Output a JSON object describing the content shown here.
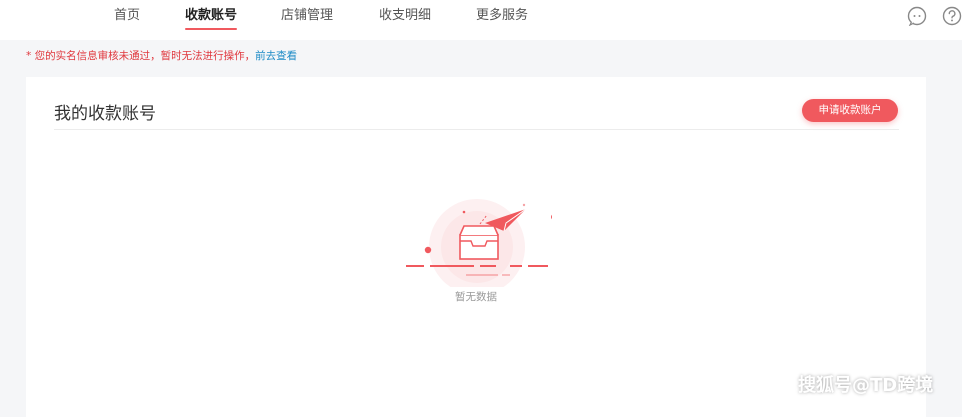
{
  "nav": {
    "items": [
      {
        "label": "首页"
      },
      {
        "label": "收款账号"
      },
      {
        "label": "店铺管理"
      },
      {
        "label": "收支明细"
      },
      {
        "label": "更多服务"
      }
    ],
    "active_index": 1,
    "icons": [
      "chat-bubble-icon",
      "help-question-icon"
    ]
  },
  "notice": {
    "message": "* 您的实名信息审核未通过，暂时无法进行操作，",
    "link_label": "前去查看"
  },
  "card": {
    "title": "我的收款账号",
    "apply_button_label": "申请收款账户",
    "empty_text": "暂无数据"
  },
  "watermark": "搜狐号@TD跨境",
  "colors": {
    "accent": "#f0595e",
    "link": "#1c8ac6",
    "warning": "#e0383e"
  }
}
